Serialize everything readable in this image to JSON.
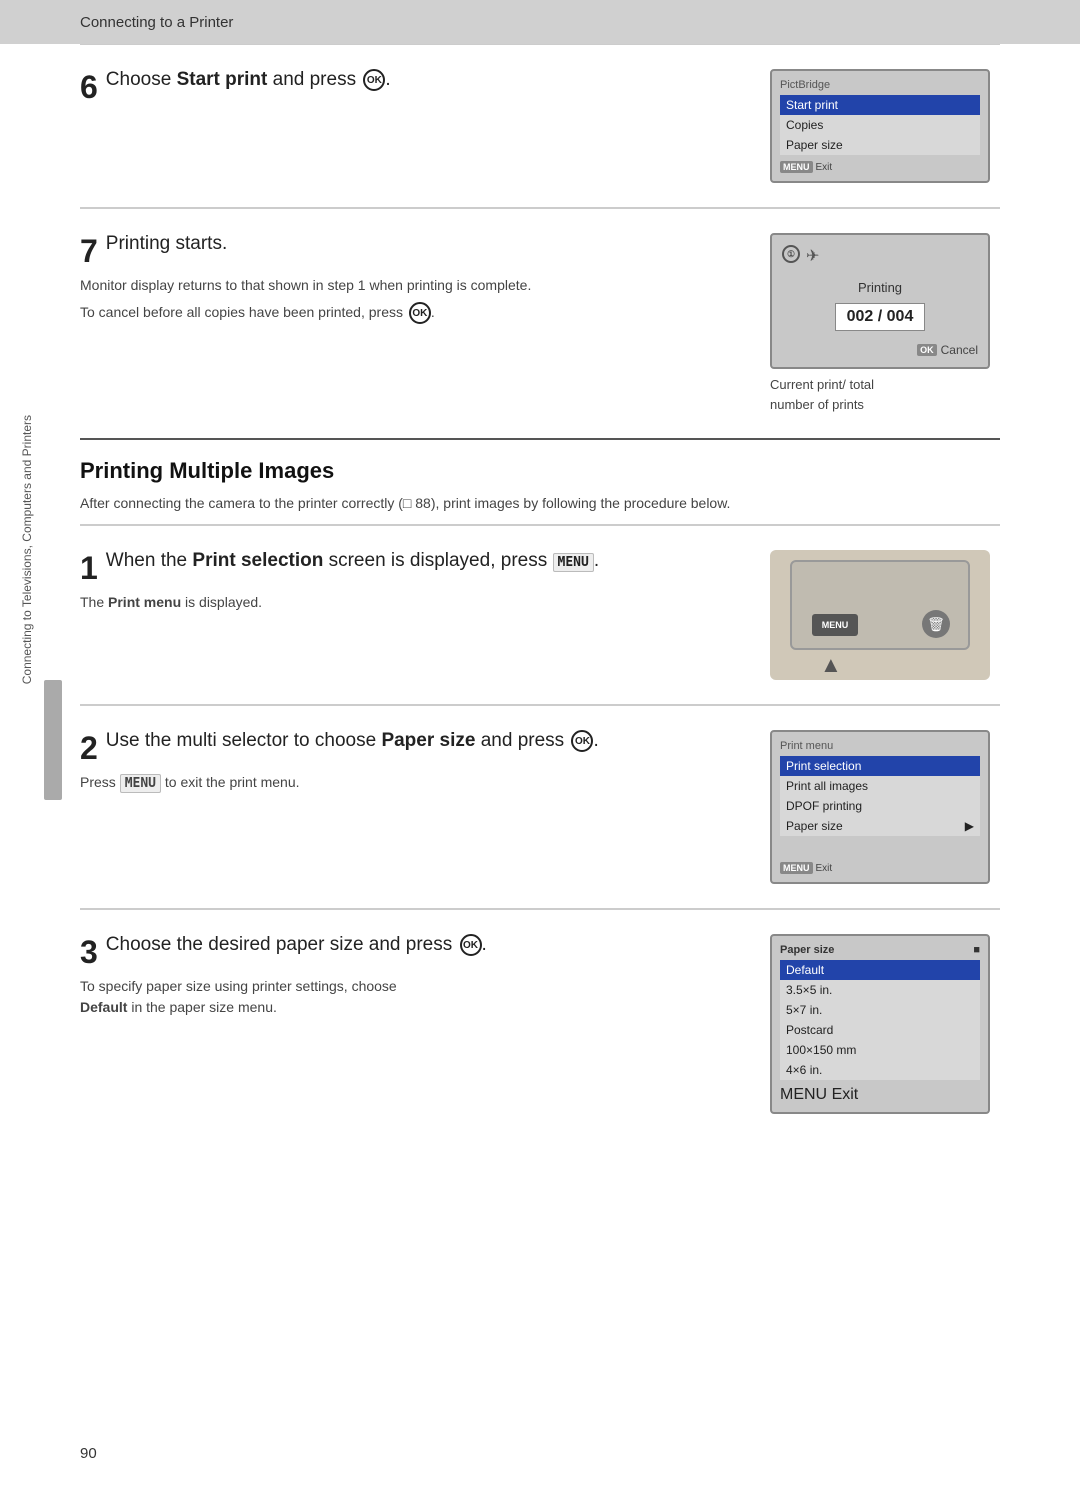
{
  "topBar": {
    "text": "Connecting to a Printer"
  },
  "sideText": "Connecting to Televisions, Computers and Printers",
  "pageNumber": "90",
  "step6": {
    "number": "6",
    "title_pre": "Choose ",
    "title_bold": "Start print",
    "title_post": " and press ",
    "screen": {
      "title": "PictBridge",
      "rows": [
        "Start print",
        "Copies",
        "Paper size"
      ],
      "highlighted": 0,
      "footer": "Exit"
    }
  },
  "step7": {
    "number": "7",
    "title": "Printing starts.",
    "body1": "Monitor display returns to that shown in step 1 when printing is complete.",
    "body2": "To cancel before all copies have been printed, press ",
    "screen": {
      "counter": "002 / 004",
      "label": "Printing",
      "cancelLabel": "Cancel"
    },
    "caption_line1": "Current print/ total",
    "caption_line2": "number of prints"
  },
  "sectionHeading": {
    "title": "Printing Multiple Images",
    "body": "After connecting the camera to the printer correctly (□ 88), print images by following the procedure below."
  },
  "step1": {
    "number": "1",
    "title_pre": "When the ",
    "title_bold": "Print selection",
    "title_post": " screen is displayed, press ",
    "title_menu": "MENU",
    "title_end": ".",
    "body_pre": "The ",
    "body_bold": "Print menu",
    "body_post": " is displayed."
  },
  "step2": {
    "number": "2",
    "title_pre": "Use the multi selector to choose ",
    "title_bold": "Paper size",
    "title_post": " and press ",
    "body_pre": "Press ",
    "body_menu": "MENU",
    "body_post": " to exit the print menu.",
    "screen": {
      "title": "Print menu",
      "rows": [
        "Print selection",
        "Print all images",
        "DPOF printing",
        "Paper size"
      ],
      "highlighted": 0,
      "footer": "Exit"
    }
  },
  "step3": {
    "number": "3",
    "title_pre": "Choose the desired paper size and press ",
    "body1": "To specify paper size using printer settings, choose",
    "body_bold": "Default",
    "body2": " in the paper size menu.",
    "screen": {
      "title": "Paper size",
      "rows": [
        "Default",
        "3.5×5 in.",
        "5×7 in.",
        "Postcard",
        "100×150 mm",
        "4×6 in."
      ],
      "highlighted": 0,
      "footer": "Exit"
    }
  }
}
